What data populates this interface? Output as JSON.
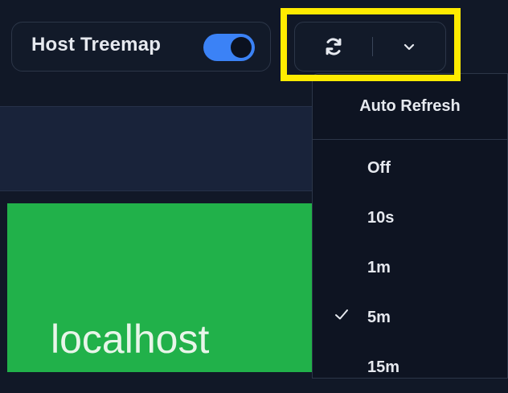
{
  "toolbar": {
    "treemap_label": "Host Treemap",
    "treemap_toggle_on": true,
    "refresh_icon": "refresh-icon",
    "caret_icon": "chevron-down-icon"
  },
  "treemap": {
    "tiles": [
      {
        "label": "localhost",
        "color": "#21b14a"
      }
    ]
  },
  "auto_refresh_menu": {
    "title": "Auto Refresh",
    "items": [
      {
        "label": "Off",
        "selected": false
      },
      {
        "label": "10s",
        "selected": false
      },
      {
        "label": "1m",
        "selected": false
      },
      {
        "label": "5m",
        "selected": true
      },
      {
        "label": "15m",
        "selected": false
      }
    ]
  },
  "colors": {
    "background": "#111827",
    "accent": "#3b82f6",
    "highlight": "#ffeb00",
    "tile_green": "#21b14a"
  }
}
